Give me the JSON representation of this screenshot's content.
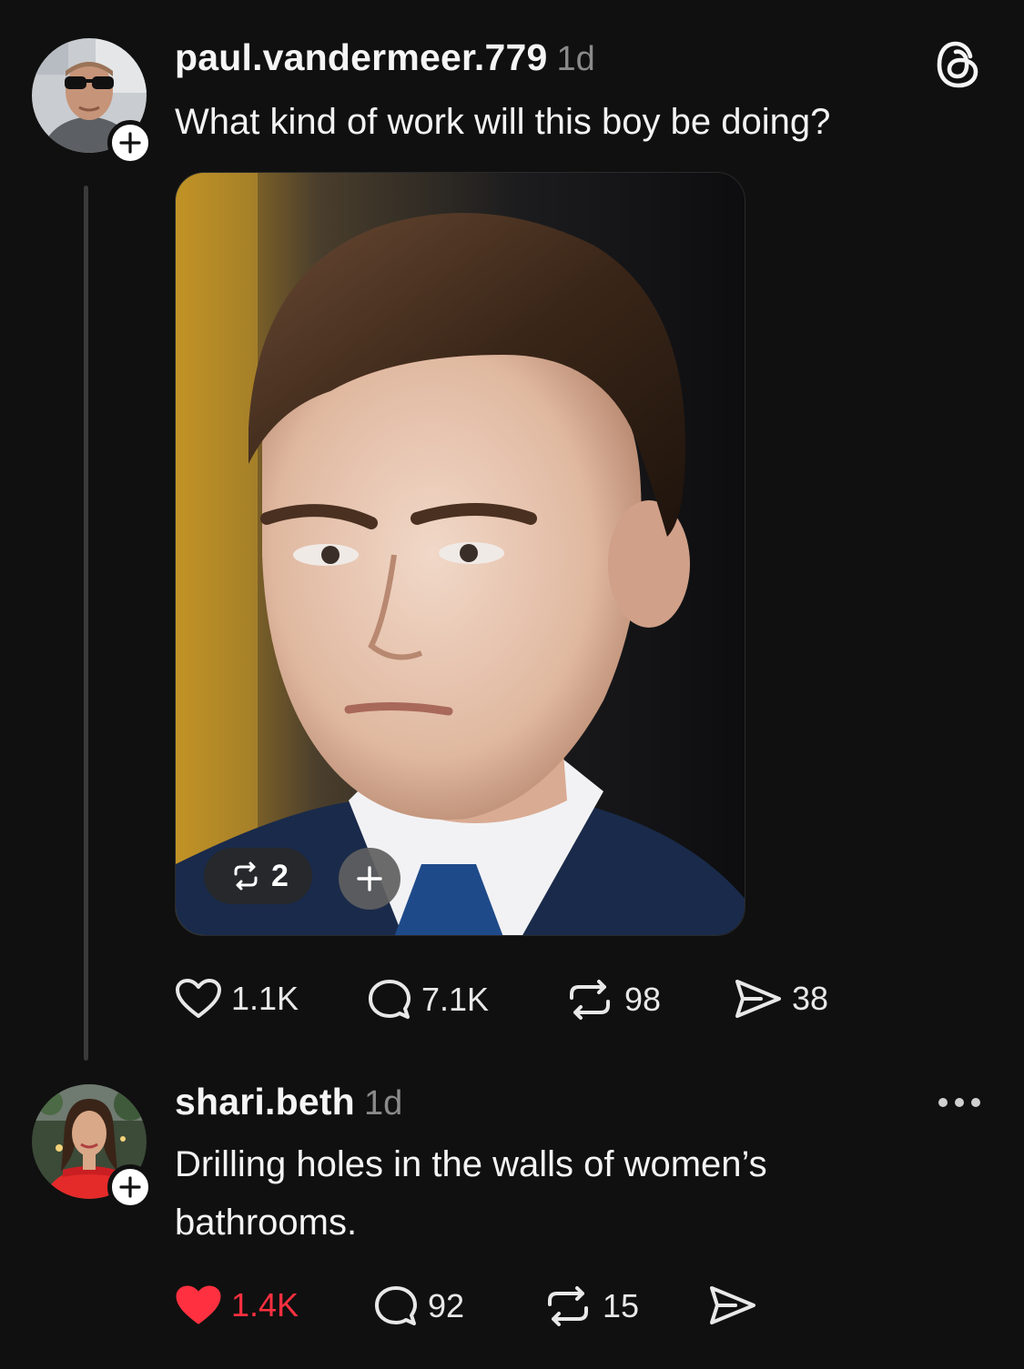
{
  "post": {
    "username": "paul.vandermeer.779",
    "time": "1d",
    "text": "What kind of work will this boy be doing?",
    "media_reposts": "2",
    "actions": {
      "likes": "1.1K",
      "replies": "7.1K",
      "reposts": "98",
      "shares": "38"
    }
  },
  "reply": {
    "username": "shari.beth",
    "time": "1d",
    "text_line1": "Drilling holes in the walls of women’s",
    "text_line2": "bathrooms.",
    "actions": {
      "likes": "1.4K",
      "replies": "92",
      "reposts": "15"
    }
  },
  "icons": {
    "app_logo": "threads-logo-icon",
    "like": "heart-icon",
    "liked": "heart-filled-icon",
    "reply": "comment-bubble-icon",
    "repost": "repost-icon",
    "share": "send-icon",
    "more": "more-dots-icon",
    "follow": "plus-icon"
  },
  "colors": {
    "background": "#101010",
    "liked": "#ff3040",
    "muted": "#8a8a8a"
  }
}
